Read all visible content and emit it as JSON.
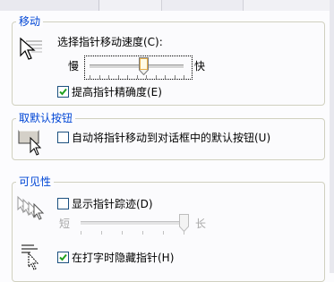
{
  "groups": {
    "motion": {
      "title": "移动",
      "speed_label": "选择指针移动速度(C):",
      "slow_label": "慢",
      "fast_label": "快",
      "speed_level": 0.57,
      "precision_label": "提高指针精确度(E)",
      "precision_checked": true
    },
    "snap_to": {
      "title": "取默认按钮",
      "snap_label": "自动将指针移动到对话框中的默认按钮(U)",
      "snap_checked": false
    },
    "visibility": {
      "title": "可见性",
      "trails_label": "显示指针踪迹(D)",
      "trails_checked": false,
      "short_label": "短",
      "long_label": "长",
      "trails_level": 1.0,
      "hide_label": "在打字时隐藏指针(H)",
      "hide_checked": true
    }
  },
  "icons": [
    "pointer-speed-icon",
    "snap-to-icon",
    "pointer-trails-icon",
    "hide-while-typing-icon",
    "checkmark-icon"
  ],
  "colors": {
    "legend": "#0046d5",
    "check": "#21a121",
    "border": "#d0d0bf"
  }
}
